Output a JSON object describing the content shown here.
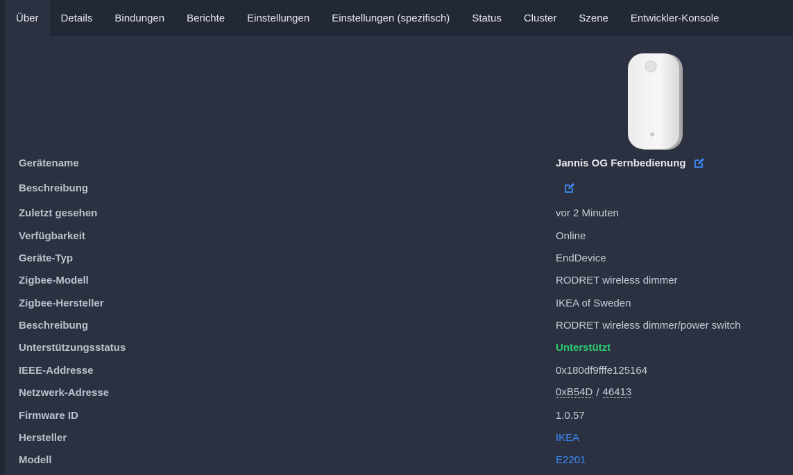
{
  "tabs": [
    {
      "label": "Über",
      "active": true
    },
    {
      "label": "Details"
    },
    {
      "label": "Bindungen"
    },
    {
      "label": "Berichte"
    },
    {
      "label": "Einstellungen"
    },
    {
      "label": "Einstellungen (spezifisch)"
    },
    {
      "label": "Status"
    },
    {
      "label": "Cluster"
    },
    {
      "label": "Szene"
    },
    {
      "label": "Entwickler-Konsole"
    }
  ],
  "device": {
    "image_icon": "ikea-rodret-remote-image",
    "rows": {
      "name": {
        "label": "Gerätename",
        "value": "Jannis OG Fernbedienung"
      },
      "description": {
        "label": "Beschreibung",
        "value": ""
      },
      "last_seen": {
        "label": "Zuletzt gesehen",
        "value": "vor 2 Minuten"
      },
      "availability": {
        "label": "Verfügbarkeit",
        "value": "Online"
      },
      "device_type": {
        "label": "Geräte-Typ",
        "value": "EndDevice"
      },
      "zigbee_model": {
        "label": "Zigbee-Modell",
        "value": "RODRET wireless dimmer"
      },
      "zigbee_manufacturer": {
        "label": "Zigbee-Hersteller",
        "value": "IKEA of Sweden"
      },
      "model_description": {
        "label": "Beschreibung",
        "value": "RODRET wireless dimmer/power switch"
      },
      "support_status": {
        "label": "Unterstützungsstatus",
        "value": "Unterstützt"
      },
      "ieee_address": {
        "label": "IEEE-Addresse",
        "value": "0x180df9fffe125164"
      },
      "network_address": {
        "label": "Netzwerk-Adresse",
        "hex": "0xB54D",
        "separator": "/",
        "dec": "46413"
      },
      "firmware_id": {
        "label": "Firmware ID",
        "value": "1.0.57"
      },
      "manufacturer": {
        "label": "Hersteller",
        "value": "IKEA"
      },
      "model": {
        "label": "Modell",
        "value": "E2201"
      }
    }
  },
  "colors": {
    "background": "#2b3141",
    "tabbar": "#222836",
    "link": "#3d8bfd",
    "supported": "#2ecc71"
  }
}
